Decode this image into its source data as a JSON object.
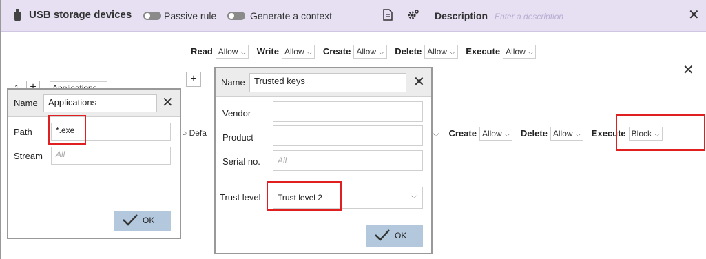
{
  "header": {
    "title": "USB storage devices",
    "passive_rule_label": "Passive rule",
    "generate_context_label": "Generate a context",
    "description_label": "Description",
    "description_placeholder": "Enter a description"
  },
  "main": {
    "permissions_top": [
      {
        "label": "Read",
        "value": "Allow"
      },
      {
        "label": "Write",
        "value": "Allow"
      },
      {
        "label": "Create",
        "value": "Allow"
      },
      {
        "label": "Delete",
        "value": "Allow"
      },
      {
        "label": "Execute",
        "value": "Allow"
      }
    ],
    "row_number": "1",
    "applications_selector": "Applications",
    "default_partial": "Defa",
    "permissions_bottom": [
      {
        "label": "Create",
        "value": "Allow"
      },
      {
        "label": "Delete",
        "value": "Allow"
      },
      {
        "label": "Execute",
        "value": "Block"
      }
    ]
  },
  "applications_popup": {
    "name_label": "Name",
    "name_value": "Applications",
    "path_label": "Path",
    "path_value": "*.exe",
    "stream_label": "Stream",
    "stream_placeholder": "All",
    "ok_label": "OK"
  },
  "trusted_popup": {
    "name_label": "Name",
    "name_value": "Trusted keys",
    "vendor_label": "Vendor",
    "product_label": "Product",
    "serial_label": "Serial no.",
    "serial_placeholder": "All",
    "trust_label": "Trust level",
    "trust_value": "Trust level 2",
    "ok_label": "OK"
  },
  "colors": {
    "header_bg": "#e7e0f3",
    "highlight": "#e02020",
    "ok_button": "#b3c7dd"
  }
}
